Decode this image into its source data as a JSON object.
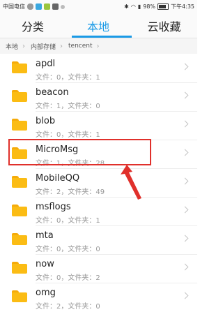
{
  "status_bar": {
    "carrier": "中国电信",
    "battery": "98%",
    "time": "下午4:35"
  },
  "tabs": [
    {
      "label": "分类",
      "active": false
    },
    {
      "label": "本地",
      "active": true
    },
    {
      "label": "云收藏",
      "active": false
    }
  ],
  "breadcrumb": [
    "本地",
    "内部存储",
    "tencent"
  ],
  "files": [
    {
      "name": "apdl",
      "meta": "文件：0，文件夹：1"
    },
    {
      "name": "beacon",
      "meta": "文件：1，文件夹：0"
    },
    {
      "name": "blob",
      "meta": "文件：0，文件夹：1"
    },
    {
      "name": "MicroMsg",
      "meta": "文件：1，文件夹：28"
    },
    {
      "name": "MobileQQ",
      "meta": "文件：2，文件夹：49"
    },
    {
      "name": "msflogs",
      "meta": "文件：0，文件夹：1"
    },
    {
      "name": "mta",
      "meta": "文件：0，文件夹：0"
    },
    {
      "name": "now",
      "meta": "文件：0，文件夹：2"
    },
    {
      "name": "omg",
      "meta": "文件：2，文件夹：0"
    }
  ],
  "colors": {
    "accent": "#1a9ae6",
    "annotation": "#e0302b",
    "folder": "#fbbc14"
  }
}
